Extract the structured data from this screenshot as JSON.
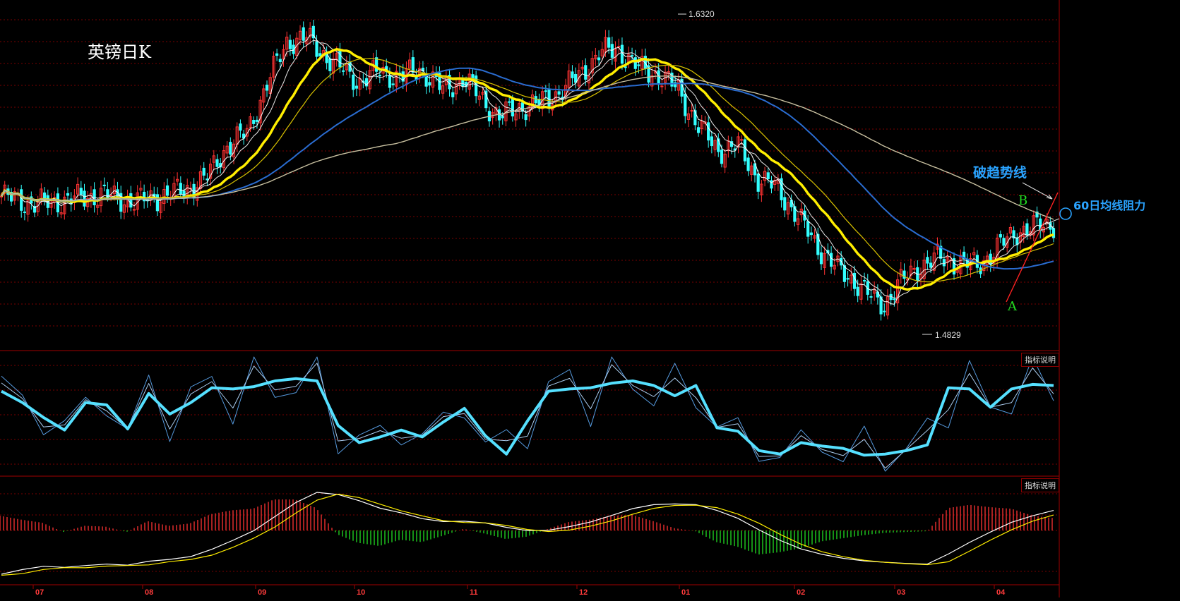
{
  "title": "英镑日K",
  "annotations": {
    "trend_break": "破趋势线",
    "ma60_resistance": "60日均线阻力",
    "point_a": "A",
    "point_b": "B"
  },
  "indicator_buttons": [
    "指标说明",
    "指标说明"
  ],
  "chart_data": [
    {
      "type": "candlestick",
      "panel": "price",
      "high_label": "1.6320",
      "low_label": "1.4829",
      "x_tick_labels": [
        "07",
        "08",
        "09",
        "10",
        "11",
        "12",
        "01",
        "02",
        "03",
        "04"
      ],
      "ylim": [
        1.472,
        1.637
      ],
      "close_anchors": [
        [
          0,
          1.542
        ],
        [
          10,
          1.538
        ],
        [
          20,
          1.54
        ],
        [
          30,
          1.543
        ],
        [
          40,
          1.539
        ],
        [
          45,
          1.541
        ],
        [
          55,
          1.545
        ],
        [
          62,
          1.552
        ],
        [
          68,
          1.568
        ],
        [
          74,
          1.575
        ],
        [
          80,
          1.6
        ],
        [
          86,
          1.622
        ],
        [
          92,
          1.624
        ],
        [
          100,
          1.611
        ],
        [
          108,
          1.601
        ],
        [
          114,
          1.607
        ],
        [
          120,
          1.603
        ],
        [
          126,
          1.608
        ],
        [
          133,
          1.597
        ],
        [
          139,
          1.603
        ],
        [
          145,
          1.592
        ],
        [
          150,
          1.583
        ],
        [
          156,
          1.588
        ],
        [
          162,
          1.59
        ],
        [
          168,
          1.596
        ],
        [
          174,
          1.604
        ],
        [
          180,
          1.616
        ],
        [
          186,
          1.618
        ],
        [
          192,
          1.608
        ],
        [
          198,
          1.605
        ],
        [
          204,
          1.597
        ],
        [
          210,
          1.578
        ],
        [
          216,
          1.566
        ],
        [
          222,
          1.568
        ],
        [
          228,
          1.551
        ],
        [
          234,
          1.546
        ],
        [
          240,
          1.531
        ],
        [
          246,
          1.516
        ],
        [
          252,
          1.504
        ],
        [
          258,
          1.497
        ],
        [
          263,
          1.488
        ],
        [
          266,
          1.486
        ],
        [
          270,
          1.496
        ],
        [
          276,
          1.505
        ],
        [
          282,
          1.51
        ],
        [
          288,
          1.508
        ],
        [
          294,
          1.506
        ],
        [
          300,
          1.515
        ],
        [
          306,
          1.524
        ],
        [
          312,
          1.526
        ],
        [
          317,
          1.528
        ]
      ],
      "moving_averages": [
        {
          "period": 5,
          "color": "#ffffff"
        },
        {
          "period": 10,
          "color": "#e8e8e8"
        },
        {
          "period": 20,
          "color": "#ffee00"
        },
        {
          "period": 30,
          "color": "#d6c000"
        },
        {
          "period": 60,
          "color": "#2a6cd0"
        },
        {
          "period": 120,
          "color": "#c8c0a0"
        }
      ],
      "up_color": "#ff3333",
      "down_color": "#33ffff"
    },
    {
      "type": "line",
      "panel": "oscillator_1",
      "ylim": [
        0,
        100
      ],
      "series": [
        {
          "color": "#55e0ff",
          "values": [
            70,
            60,
            47,
            36,
            60,
            58,
            37,
            68,
            50,
            60,
            73,
            72,
            74,
            79,
            81,
            79,
            40,
            25,
            30,
            36,
            30,
            43,
            55,
            31,
            15,
            44,
            70,
            72,
            73,
            77,
            79,
            75,
            66,
            75,
            38,
            35,
            18,
            15,
            25,
            22,
            20,
            14,
            15,
            18,
            23,
            73,
            72,
            56,
            72,
            76,
            75
          ]
        },
        {
          "color": "#5599dd",
          "values": []
        },
        {
          "color": "#aaccee",
          "values": []
        }
      ]
    },
    {
      "type": "bar",
      "panel": "macd",
      "ylim": [
        -1,
        1
      ],
      "histogram": [
        0.19,
        0.14,
        0.1,
        -0.02,
        0.06,
        0.05,
        -0.02,
        0.12,
        0.06,
        0.09,
        0.21,
        0.26,
        0.28,
        0.4,
        0.4,
        0.29,
        -0.05,
        -0.16,
        -0.2,
        -0.12,
        -0.15,
        -0.07,
        0.02,
        -0.04,
        -0.11,
        -0.08,
        0.02,
        0.11,
        0.14,
        0.19,
        0.2,
        0.12,
        0.03,
        -0.01,
        -0.15,
        -0.21,
        -0.31,
        -0.28,
        -0.23,
        -0.14,
        -0.1,
        -0.06,
        -0.03,
        -0.02,
        -0.01,
        0.29,
        0.33,
        0.3,
        0.28,
        0.19,
        0.16
      ],
      "dif_color": "#ffffff",
      "dea_color": "#ffee00"
    }
  ]
}
